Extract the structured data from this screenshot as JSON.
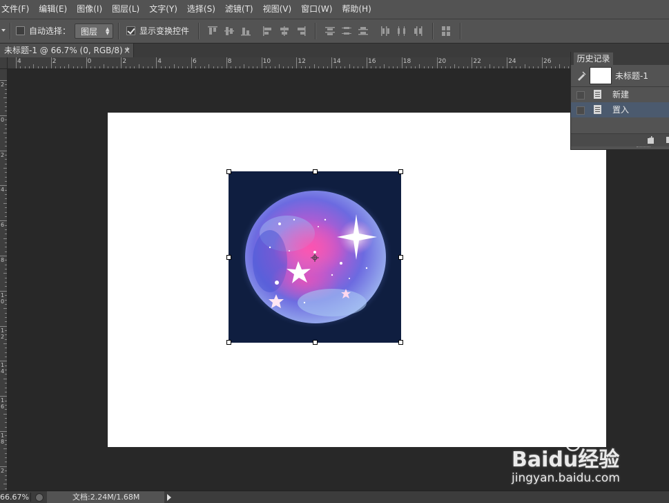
{
  "menu": [
    "文件(F)",
    "编辑(E)",
    "图像(I)",
    "图层(L)",
    "文字(Y)",
    "选择(S)",
    "滤镜(T)",
    "视图(V)",
    "窗口(W)",
    "帮助(H)"
  ],
  "options": {
    "auto_select_label": "自动选择：",
    "auto_select_checked": false,
    "layer_select_value": "图层",
    "show_transform_label": "显示变换控件",
    "show_transform_checked": true
  },
  "document_tab": {
    "title": "未标题-1 @ 66.7% (0, RGB/8) *",
    "close": "×"
  },
  "ruler": {
    "h_labels": [
      "4",
      "2",
      "0",
      "2",
      "4",
      "6",
      "8",
      "10",
      "12",
      "14",
      "16",
      "18",
      "20",
      "22",
      "24",
      "26"
    ],
    "v_labels": [
      "2",
      "0",
      "2",
      "4",
      "6",
      "8",
      "1 0",
      "1 2",
      "1 4",
      "1 6",
      "1 8",
      "2"
    ]
  },
  "history_panel": {
    "tab_label": "历史记录",
    "snapshot_label": "未标题-1",
    "items": [
      {
        "label": "新建",
        "selected": false
      },
      {
        "label": "置入",
        "selected": true
      }
    ]
  },
  "status": {
    "zoom": "66.67%",
    "doc_info": "文档:2.24M/1.68M"
  },
  "watermark": {
    "brand": "Baidu经验",
    "url": "jingyan.baidu.com"
  },
  "colors": {
    "ui_bg": "#535353",
    "workspace": "#282828",
    "canvas": "#ffffff",
    "image_bg": "#0f1e40",
    "selected_row": "#4b5a6e"
  }
}
